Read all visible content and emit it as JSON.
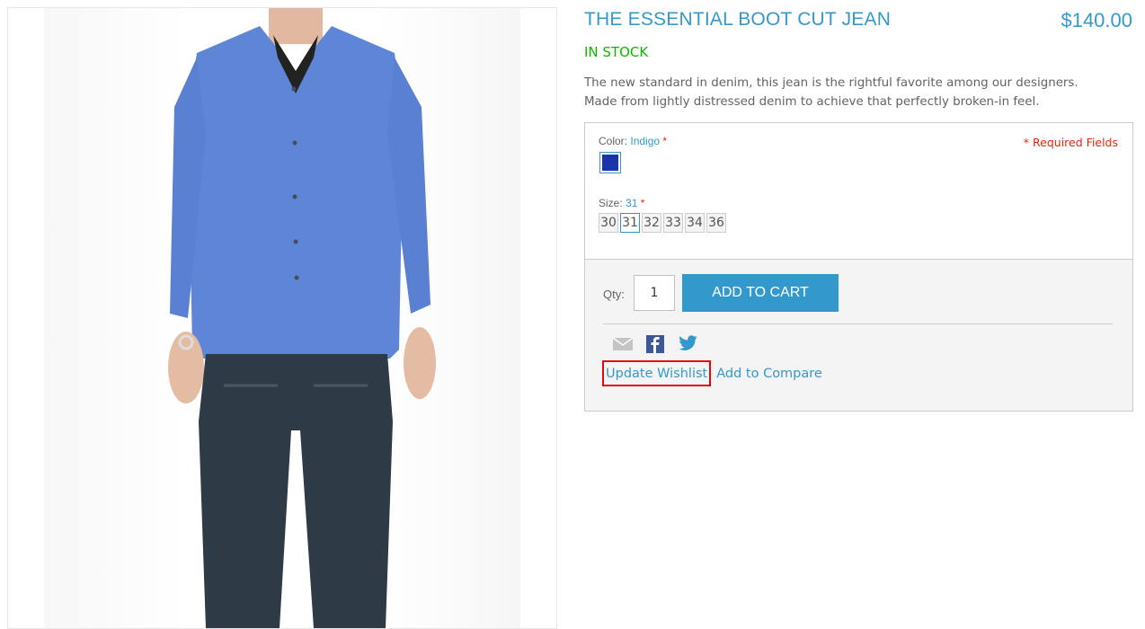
{
  "product": {
    "title": "THE ESSENTIAL BOOT CUT JEAN",
    "price": "$140.00",
    "stock": "IN STOCK",
    "description_line1": "The new standard in denim, this jean is the rightful favorite among our designers.",
    "description_line2": "Made from lightly distressed denim to achieve that perfectly broken-in feel."
  },
  "options": {
    "color_label": "Color:",
    "color_value": "Indigo",
    "required_mark": "*",
    "required_fields": "* Required Fields",
    "swatch_color": "#1a35a8",
    "size_label": "Size:",
    "size_value": "31",
    "sizes": [
      "30",
      "31",
      "32",
      "33",
      "34",
      "36"
    ]
  },
  "cart": {
    "qty_label": "Qty:",
    "qty_value": "1",
    "add_to_cart": "ADD TO CART"
  },
  "share": {
    "icons": [
      "email-icon",
      "facebook-icon",
      "twitter-icon"
    ]
  },
  "links": {
    "update_wishlist": "Update Wishlist",
    "add_to_compare": "Add to Compare"
  },
  "colors": {
    "accent": "#3399cc",
    "stock": "#11b400",
    "required": "#df280a",
    "highlight": "#e8080a"
  }
}
